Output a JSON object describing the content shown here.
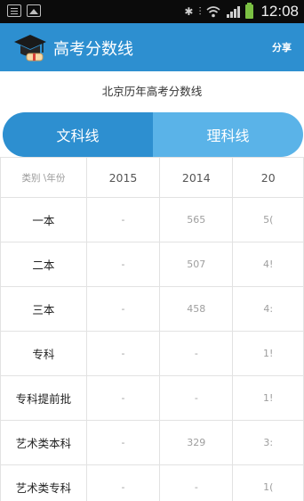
{
  "status_bar": {
    "icons": [
      "document-icon",
      "image-icon",
      "bluetooth-icon",
      "vibrate-icon",
      "wifi-icon",
      "signal-icon",
      "battery-icon"
    ],
    "time": "12:08"
  },
  "app_bar": {
    "title": "高考分数线",
    "share_label": "分享",
    "logo_icon": "graduation-cap-icon"
  },
  "subtitle": "北京历年高考分数线",
  "tabs": [
    {
      "label": "文科线",
      "active": true
    },
    {
      "label": "理科线",
      "active": false
    }
  ],
  "table": {
    "corner_label": "类别 \\年份",
    "years": [
      "2015",
      "2014",
      "20"
    ],
    "rows": [
      {
        "label": "一本",
        "values": [
          "-",
          "565",
          "5("
        ]
      },
      {
        "label": "二本",
        "values": [
          "-",
          "507",
          "4!"
        ]
      },
      {
        "label": "三本",
        "values": [
          "-",
          "458",
          "4:"
        ]
      },
      {
        "label": "专科",
        "values": [
          "-",
          "-",
          "1!"
        ]
      },
      {
        "label": "专科提前批",
        "values": [
          "-",
          "-",
          "1!"
        ]
      },
      {
        "label": "艺术类本科",
        "values": [
          "-",
          "329",
          "3:"
        ]
      },
      {
        "label": "艺术类专科",
        "values": [
          "-",
          "-",
          "1("
        ]
      }
    ]
  },
  "colors": {
    "primary": "#2d8fd0",
    "tab_inactive": "#5ab3e8",
    "status_bar": "#0b0b0b"
  }
}
